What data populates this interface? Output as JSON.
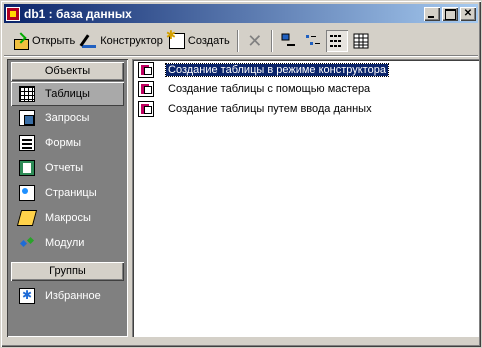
{
  "window": {
    "title": "db1 : база данных"
  },
  "toolbar": {
    "open_label": "Открыть",
    "design_label": "Конструктор",
    "create_label": "Создать"
  },
  "sidebar": {
    "objects_header": "Объекты",
    "items": [
      {
        "label": "Таблицы",
        "icon": "table-icon"
      },
      {
        "label": "Запросы",
        "icon": "query-icon"
      },
      {
        "label": "Формы",
        "icon": "form-icon"
      },
      {
        "label": "Отчеты",
        "icon": "report-icon"
      },
      {
        "label": "Страницы",
        "icon": "page-icon"
      },
      {
        "label": "Макросы",
        "icon": "macro-icon"
      },
      {
        "label": "Модули",
        "icon": "module-icon"
      }
    ],
    "groups_header": "Группы",
    "group_items": [
      {
        "label": "Избранное",
        "icon": "favorites-icon"
      }
    ]
  },
  "content": {
    "items": [
      {
        "label": "Создание таблицы в режиме конструктора"
      },
      {
        "label": "Создание таблицы с помощью мастера"
      },
      {
        "label": "Создание таблицы путем ввода данных"
      }
    ]
  }
}
